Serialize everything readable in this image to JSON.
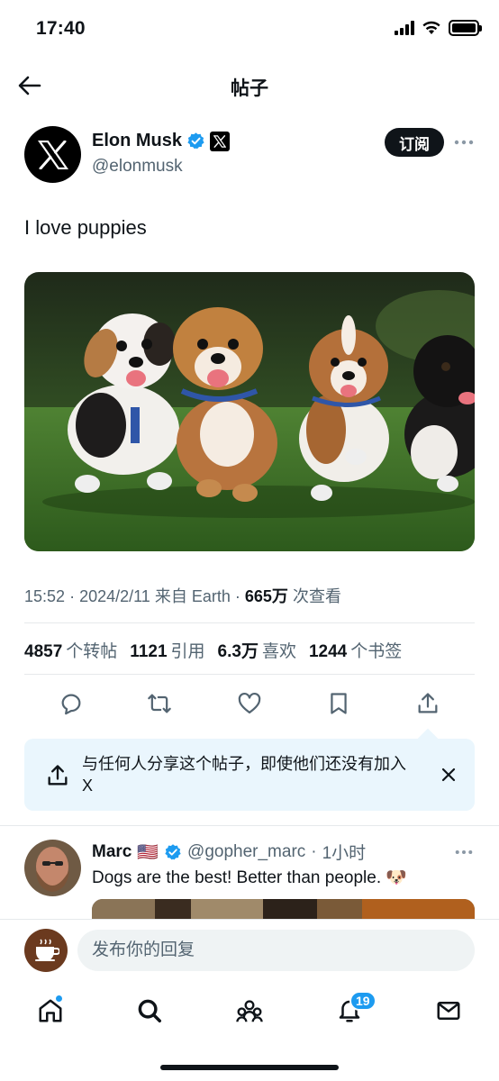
{
  "status_bar": {
    "time": "17:40"
  },
  "nav": {
    "title": "帖子"
  },
  "author": {
    "name": "Elon Musk",
    "handle": "@elonmusk",
    "subscribe_label": "订阅"
  },
  "post": {
    "text": "I love puppies",
    "time": "15:52",
    "date": "2024/2/11",
    "source_prefix": "来自",
    "source": "Earth",
    "views": "665万",
    "views_label": "次查看"
  },
  "stats": {
    "reposts": "4857",
    "reposts_label": "个转帖",
    "quotes": "1121",
    "quotes_label": "引用",
    "likes": "6.3万",
    "likes_label": "喜欢",
    "bookmarks": "1244",
    "bookmarks_label": "个书签"
  },
  "share_tip": {
    "text": "与任何人分享这个帖子，即使他们还没有加入 X"
  },
  "reply": {
    "name": "Marc",
    "flag": "🇺🇸",
    "handle": "@gopher_marc",
    "time": "1小时",
    "text": "Dogs are the best! Better than people. 🐶"
  },
  "compose": {
    "placeholder": "发布你的回复"
  },
  "tabbar": {
    "notifications_badge": "19"
  },
  "colors": {
    "accent": "#1d9bf0",
    "text": "#0f1419",
    "secondary": "#536471",
    "tip_bg": "#eaf6fd"
  }
}
